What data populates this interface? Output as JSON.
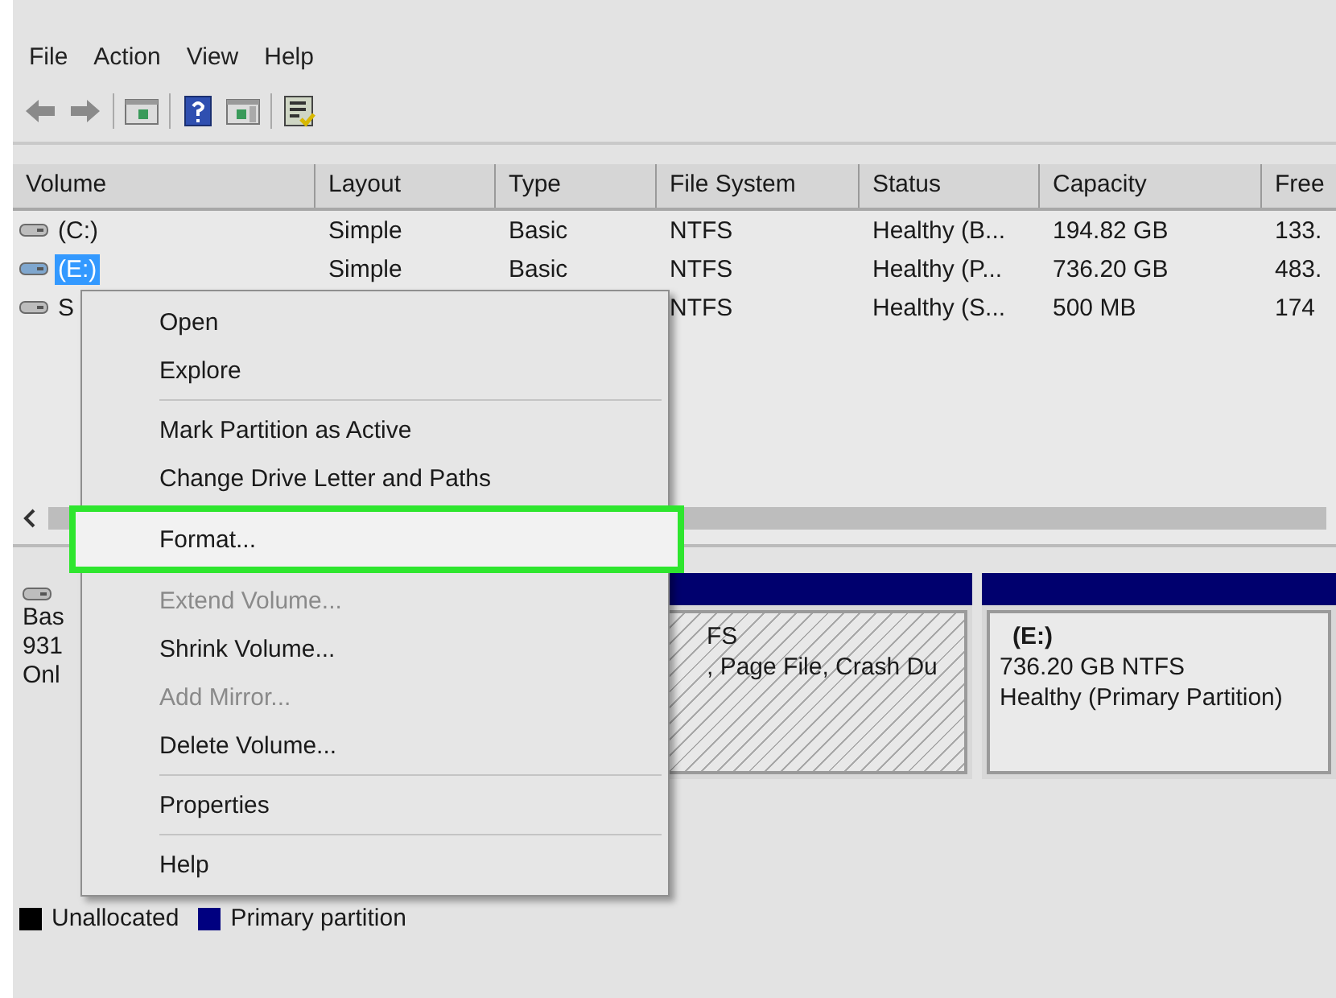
{
  "menu_bar": [
    "File",
    "Action",
    "View",
    "Help"
  ],
  "table": {
    "columns": [
      "Volume",
      "Layout",
      "Type",
      "File System",
      "Status",
      "Capacity",
      "Free"
    ],
    "rows": [
      {
        "cells": [
          "(C:)",
          "Simple",
          "Basic",
          "NTFS",
          "Healthy (B...",
          "194.82 GB",
          "133."
        ],
        "selected": false
      },
      {
        "cells": [
          "(E:)",
          "Simple",
          "Basic",
          "NTFS",
          "Healthy (P...",
          "736.20 GB",
          "483."
        ],
        "selected": true
      },
      {
        "cells": [
          "S",
          null,
          null,
          "NTFS",
          "Healthy (S...",
          "500 MB",
          "174"
        ],
        "selected": false
      }
    ]
  },
  "disk": {
    "info": [
      "Bas",
      "931",
      "Onl"
    ],
    "partitions": [
      {
        "lines": [
          "FS",
          ", Page File, Crash Du"
        ],
        "hatched": true
      },
      {
        "name": "(E:)",
        "lines": [
          "736.20 GB NTFS",
          "Healthy (Primary Partition)"
        ],
        "hatched": false
      }
    ]
  },
  "legend": [
    {
      "label": "Unallocated",
      "color": "#000000"
    },
    {
      "label": "Primary partition",
      "color": "#000080"
    }
  ],
  "context_menu": [
    {
      "kind": "item",
      "label": "Open",
      "disabled": false,
      "highlighted": false
    },
    {
      "kind": "item",
      "label": "Explore",
      "disabled": false,
      "highlighted": false
    },
    {
      "kind": "separator"
    },
    {
      "kind": "item",
      "label": "Mark Partition as Active",
      "disabled": false,
      "highlighted": false
    },
    {
      "kind": "item",
      "label": "Change Drive Letter and Paths",
      "disabled": false,
      "highlighted": false
    },
    {
      "kind": "item",
      "label": "Format...",
      "disabled": false,
      "highlighted": true
    },
    {
      "kind": "item",
      "label": "Extend Volume...",
      "disabled": true,
      "highlighted": false
    },
    {
      "kind": "item",
      "label": "Shrink Volume...",
      "disabled": false,
      "highlighted": false
    },
    {
      "kind": "item",
      "label": "Add Mirror...",
      "disabled": true,
      "highlighted": false
    },
    {
      "kind": "item",
      "label": "Delete Volume...",
      "disabled": false,
      "highlighted": false
    },
    {
      "kind": "separator"
    },
    {
      "kind": "item",
      "label": "Properties",
      "disabled": false,
      "highlighted": false
    },
    {
      "kind": "separator"
    },
    {
      "kind": "item",
      "label": "Help",
      "disabled": false,
      "highlighted": false
    }
  ]
}
